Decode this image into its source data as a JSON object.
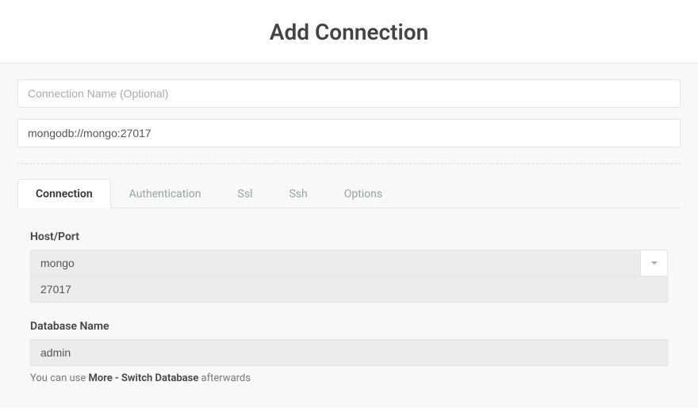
{
  "header": {
    "title": "Add Connection"
  },
  "form": {
    "connection_name": {
      "value": "",
      "placeholder": "Connection Name (Optional)"
    },
    "connection_uri": {
      "value": "mongodb://mongo:27017"
    }
  },
  "tabs": {
    "connection": "Connection",
    "authentication": "Authentication",
    "ssl": "Ssl",
    "ssh": "Ssh",
    "options": "Options"
  },
  "connection_tab": {
    "host_port_label": "Host/Port",
    "host": "mongo",
    "port": "27017",
    "database_label": "Database Name",
    "database": "admin",
    "hint_prefix": "You can use ",
    "hint_strong": "More - Switch Database",
    "hint_suffix": " afterwards"
  }
}
